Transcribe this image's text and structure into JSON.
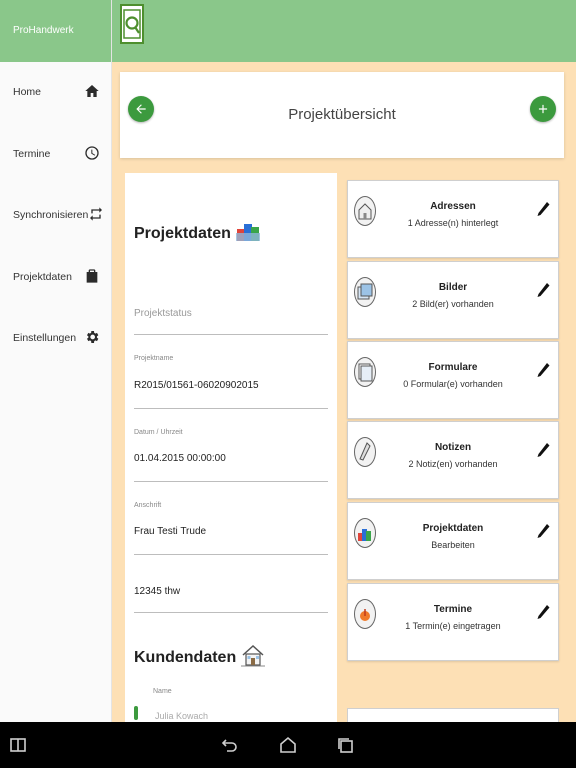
{
  "app": {
    "name": "ProHandwerk"
  },
  "sidebar": {
    "items": [
      {
        "label": "Home",
        "icon": "home-icon"
      },
      {
        "label": "Termine",
        "icon": "clock-icon"
      },
      {
        "label": "Synchronisieren",
        "icon": "sync-icon"
      },
      {
        "label": "Projektdaten",
        "icon": "briefcase-icon"
      },
      {
        "label": "Einstellungen",
        "icon": "gear-icon"
      }
    ]
  },
  "header": {
    "title": "Projektübersicht"
  },
  "projektdaten": {
    "title": "Projektdaten",
    "status_placeholder": "Projektstatus",
    "projektname_label": "Projektname",
    "projektname_value": "R2015/01561-06020902015",
    "datum_label": "Datum / Uhrzeit",
    "datum_value": "01.04.2015 00:00:00",
    "anschrift_label": "Anschrift",
    "anschrift_value": "Frau Testi Trude",
    "ort_value": "12345 thw"
  },
  "kundendaten": {
    "title": "Kundendaten",
    "name_label": "Name",
    "name_value": "Julia Kowach"
  },
  "tiles": [
    {
      "title": "Adressen",
      "subtitle": "1 Adresse(n) hinterlegt",
      "icon": "address-icon"
    },
    {
      "title": "Bilder",
      "subtitle": "2 Bild(er) vorhanden",
      "icon": "pictures-icon"
    },
    {
      "title": "Formulare",
      "subtitle": "0 Formular(e) vorhanden",
      "icon": "forms-icon"
    },
    {
      "title": "Notizen",
      "subtitle": "2 Notiz(en) vorhanden",
      "icon": "notes-icon"
    },
    {
      "title": "Projektdaten",
      "subtitle": "Bearbeiten",
      "icon": "project-data-icon"
    },
    {
      "title": "Termine",
      "subtitle": "1 Termin(e) eingetragen",
      "icon": "appointment-icon"
    }
  ],
  "colors": {
    "accent": "#3c9a3e",
    "header": "#8ac78a",
    "background": "#fde0b5"
  }
}
